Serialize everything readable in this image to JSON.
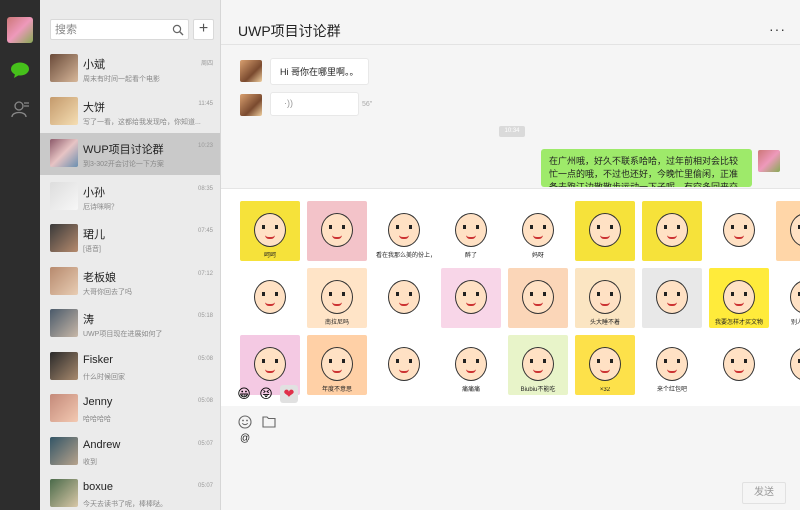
{
  "search": {
    "placeholder": "搜索"
  },
  "sidebar": {
    "conversations": [
      {
        "name": "小斌",
        "preview": "周末有时间一起看个电影",
        "time": "周四"
      },
      {
        "name": "大饼",
        "preview": "写了一看，这都给我发现哈，你知道...",
        "time": "11:45"
      },
      {
        "name": "WUP项目讨论群",
        "preview": "到3-302开会讨论一下方案",
        "time": "10:23"
      },
      {
        "name": "小孙",
        "preview": "厄诗咪啊？",
        "time": "08:35"
      },
      {
        "name": "珺儿",
        "preview": "[语音]",
        "time": "07:45"
      },
      {
        "name": "老板娘",
        "preview": "大哥你回去了吗",
        "time": "07:12"
      },
      {
        "name": "涛",
        "preview": "UWP项目现在进展如何了",
        "time": "05:18"
      },
      {
        "name": "Fisker",
        "preview": "什么时候回家",
        "time": "05:08"
      },
      {
        "name": "Jenny",
        "preview": "哈哈哈哈",
        "time": "05:08"
      },
      {
        "name": "Andrew",
        "preview": "收到",
        "time": "05:07"
      },
      {
        "name": "boxue",
        "preview": "今天去读书了呢，棒棒哒。",
        "time": "05:07"
      }
    ]
  },
  "chat": {
    "title": "UWP项目讨论群",
    "more_icon": "···",
    "messages": [
      {
        "text": "Hi 哥你在哪里啊。。"
      },
      {
        "voice_glyph": "·))",
        "voice_length": "56\""
      }
    ],
    "timestamp": "10:34",
    "outgoing": "在广州哦，好久不联系哈哈，过年前相对会比较忙一点的哦，不过也还好，今晚忙里偷闲，正准备去跑江边散散步运动一下子呢，有空多回来交流哦"
  },
  "stickers": {
    "captions": [
      "呵呵",
      "",
      "看在我那么美的份上，你就买个红包吧",
      "醉了",
      "妈呀",
      "",
      "",
      "",
      "",
      "",
      "南拉尼吗",
      "",
      "",
      "",
      "头大睡不着",
      "",
      "我要怎样才买文物",
      "别人美哦哦",
      "",
      "年度不意思",
      "",
      "痛痛痛",
      "Biubiu不能吃",
      "×32",
      "来个红包吧",
      "",
      ""
    ],
    "tabs": [
      "😀",
      "😝",
      "❤"
    ]
  },
  "compose": {
    "at_text": "@",
    "send_label": "发送"
  },
  "colors": {
    "rail": "#2d2d2d",
    "list": "#ebebeb",
    "bubble_green": "#9eea6a",
    "active_row": "#c9c9c9"
  }
}
